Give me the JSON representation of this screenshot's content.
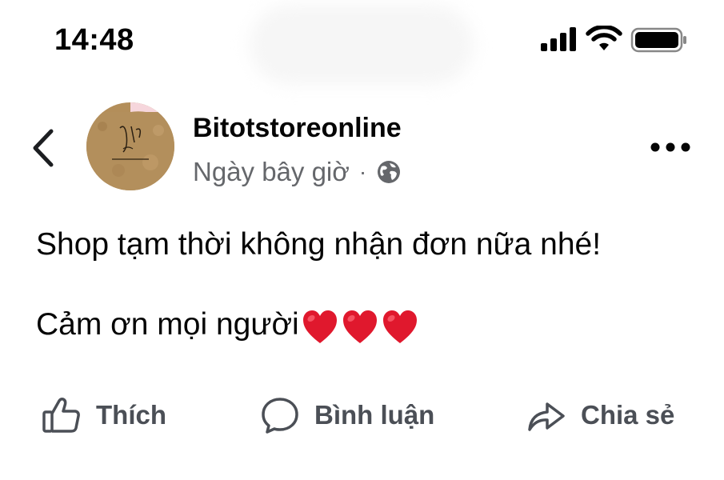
{
  "status_bar": {
    "time": "14:48"
  },
  "post": {
    "page_name": "Bitotstoreonline",
    "timestamp": "Ngày bây giờ",
    "separator": "·",
    "audience_icon": "globe-icon",
    "lines": [
      "Shop tạm thời không nhận đơn nữa nhé!",
      "Cảm ơn mọi người"
    ],
    "emoji": [
      "❤️",
      "❤️",
      "❤️"
    ]
  },
  "actions": {
    "like": "Thích",
    "comment": "Bình luận",
    "share": "Chia sẻ"
  },
  "colors": {
    "text_primary": "#050505",
    "text_secondary": "#65676b",
    "action_text": "#4b4f56",
    "heart": "#e0182d"
  }
}
